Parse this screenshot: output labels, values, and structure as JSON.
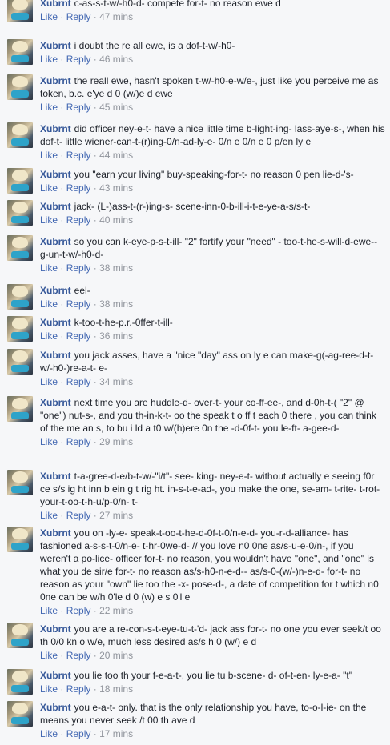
{
  "comments": [
    {
      "author": "Xubrnt",
      "text": "c-as-s-t-w/-h0-d- compete for-t- no reason ewe d",
      "time": "47 mins"
    },
    {
      "author": "Xubrnt",
      "text": "i doubt the re all ewe, is a dof-t-w/-h0-",
      "time": "46 mins"
    },
    {
      "author": "Xubrnt",
      "text": "the reall ewe, hasn't spoken t-w/-h0-e-w/e-, just like you perceive me as token, b.c. e'ye d 0 (w/)e d ewe",
      "time": "45 mins"
    },
    {
      "author": "Xubrnt",
      "text": "did officer ney-e-t- have a nice little time b-light-ing- lass-aye-s-, when his dof-t- little wiener-can-t-(r)ing-0/n-ad-ly-e- 0/n e 0/n e 0 p/en ly e",
      "time": "44 mins"
    },
    {
      "author": "Xubrnt",
      "text": "you \"earn your living\" buy-speaking-for-t- no reason 0 pen lie-d-'s-",
      "time": "43 mins"
    },
    {
      "author": "Xubrnt",
      "text": "jack- (L-)ass-t-(r-)ing-s- scene-inn-0-b-ill-i-t-e-ye-a-s/s-t-",
      "time": "40 mins"
    },
    {
      "author": "Xubrnt",
      "text": "so you can k-eye-p-s-t-ill- \"2\" fortify your \"need\" - too-t-he-s-will-d-ewe--g-un-t-w/-h0-d-",
      "time": "38 mins"
    },
    {
      "author": "Xubrnt",
      "text": "eel-",
      "time": "38 mins"
    },
    {
      "author": "Xubrnt",
      "text": "k-too-t-he-p.r.-0ffer-t-ill-",
      "time": "36 mins"
    },
    {
      "author": "Xubrnt",
      "text": "you jack asses, have a \"nice \"day\" ass on ly e can make-g(-ag-ree-d-t-w/-h0-)re-a-t- e-",
      "time": "34 mins"
    },
    {
      "author": "Xubrnt",
      "text": "next time you are huddle-d- over-t- your co-ff-ee-, and d-0h-t-( \"2\" @ \"one\") nut-s-, and you th-in-k-t- oo the speak t o ff t each 0 there , you can think of the me an s, to bu i ld a t0 w/(h)ere 0n the -d-0f-t- you le-ft- a-gee-d-",
      "time": "29 mins"
    },
    {
      "author": "Xubrnt",
      "text": "t-a-gree-d-e/b-t-w/-\"i/t\"- see- king- ney-e-t- without actually e seeing f0r ce s/s ig ht inn b ein g t rig ht. in-s-t-e-ad-, you make the one, se-am- t-rite- t-rot- your-t-oo-t-h-u/p-0/n- t-",
      "time": "27 mins"
    },
    {
      "author": "Xubrnt",
      "text": "you on -ly-e- speak-t-oo-t-he-d-0f-t-0/n-e-d- you-r-d-alliance- has fashioned a-s-s-t-0/n-e- t-hr-0we-d- // you love n0 0ne as/s-u-e-0/n-, if you weren't a po-lice- officer for-t- no reason, you wouldn't have \"one\", and \"one\" is what you de sir/e for-t- no reason as/s-h0-n-e-d-- as/s-0-(w/-)n-e-d- for-t- no reason as your \"own\" lie too the -x- pose-d-, a date of competition for t which n0 0ne can be w/h 0'le d 0 (w) e s 0'l e",
      "time": "22 mins"
    },
    {
      "author": "Xubrnt",
      "text": "you are a re-con-s-t-eye-tu-t-'d- jack ass for-t- no one you ever seek/t oo th 0/0 kn o w/e, much less desired as/s h 0 (w/) e d",
      "time": "20 mins"
    },
    {
      "author": "Xubrnt",
      "text": "you lie too th your f-e-a-t-, you lie tu b-scene- d- of-t-en- ly-e-a- \"t\"",
      "time": "18 mins"
    },
    {
      "author": "Xubrnt",
      "text": "you e-a-t- only. that is the only relationship you have, to-o-l-ie- on the means you never seek /t 00 th ave d",
      "time": "17 mins"
    }
  ],
  "labels": {
    "like": "Like",
    "reply": "Reply",
    "sep": "·"
  }
}
